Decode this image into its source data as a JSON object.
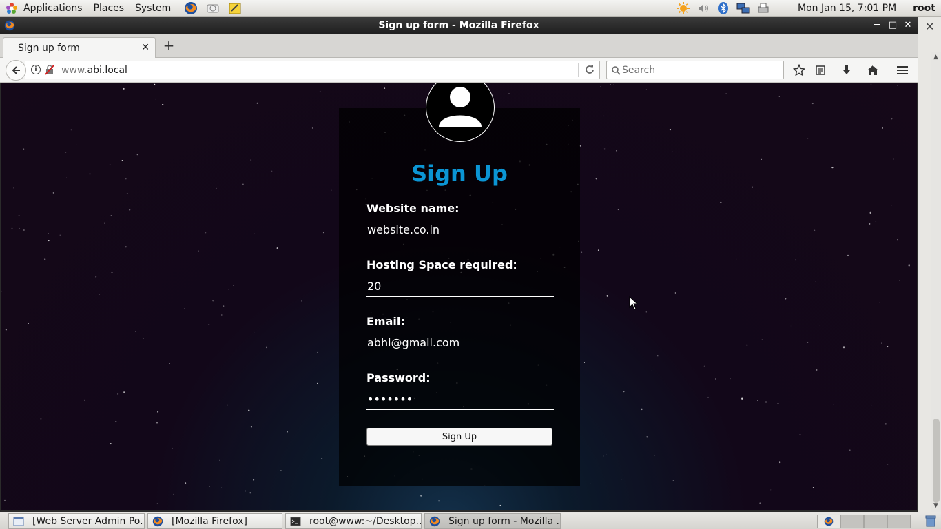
{
  "top_panel": {
    "menus": [
      "Applications",
      "Places",
      "System"
    ],
    "launchers": [
      "firefox-icon",
      "mail-icon",
      "notes-icon"
    ],
    "tray": [
      "weather-sun-icon",
      "volume-icon",
      "bluetooth-icon",
      "network-icon",
      "printer-icon"
    ],
    "clock": "Mon Jan 15,  7:01 PM",
    "user": "root"
  },
  "window": {
    "title": "Sign up form - Mozilla Firefox"
  },
  "browser": {
    "tab_label": "Sign up form",
    "url_prefix": "www.",
    "url_domain": "abi.local",
    "search_placeholder": "Search"
  },
  "page": {
    "heading": "Sign Up",
    "fields": [
      {
        "label": "Website name:",
        "value": "website.co.in",
        "type": "text"
      },
      {
        "label": "Hosting Space required:",
        "value": "20",
        "type": "text"
      },
      {
        "label": "Email:",
        "value": "abhi@gmail.com",
        "type": "text"
      },
      {
        "label": "Password:",
        "value": "abcdefg",
        "type": "password"
      }
    ],
    "submit_label": "Sign Up",
    "colors": {
      "heading": "#0b95d4",
      "card": "#000000",
      "background": "#150818"
    }
  },
  "taskbar": {
    "tasks": [
      {
        "label": "[Web Server Admin Po...",
        "icon": "window-icon",
        "active": false
      },
      {
        "label": "[Mozilla Firefox]",
        "icon": "firefox-icon",
        "active": false
      },
      {
        "label": "root@www:~/Desktop...",
        "icon": "terminal-icon",
        "active": false
      },
      {
        "label": "Sign up form - Mozilla ...",
        "icon": "firefox-icon",
        "active": true
      }
    ]
  }
}
